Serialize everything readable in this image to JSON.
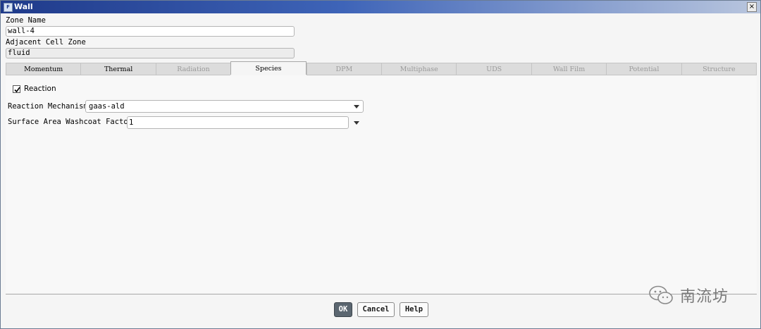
{
  "window": {
    "title": "Wall",
    "title_icon": "F",
    "close_icon": "close-icon",
    "close_glyph": "×"
  },
  "zone": {
    "name_label": "Zone Name",
    "name_value": "wall-4",
    "cell_zone_label": "Adjacent Cell Zone",
    "cell_zone_value": "fluid"
  },
  "tabs": [
    {
      "label": "Momentum",
      "state": "enabled"
    },
    {
      "label": "Thermal",
      "state": "enabled"
    },
    {
      "label": "Radiation",
      "state": "disabled"
    },
    {
      "label": "Species",
      "state": "active"
    },
    {
      "label": "DPM",
      "state": "disabled"
    },
    {
      "label": "Multiphase",
      "state": "disabled"
    },
    {
      "label": "UDS",
      "state": "disabled"
    },
    {
      "label": "Wall Film",
      "state": "disabled"
    },
    {
      "label": "Potential",
      "state": "disabled"
    },
    {
      "label": "Structure",
      "state": "disabled"
    }
  ],
  "species": {
    "reaction_label": "Reaction",
    "reaction_checked": true,
    "mechanism_label": "Reaction Mechanism",
    "mechanism_value": "gaas-ald",
    "washcoat_label": "Surface Area Washcoat Factor",
    "washcoat_value": "1"
  },
  "buttons": {
    "ok": "OK",
    "cancel": "Cancel",
    "help": "Help"
  },
  "watermark": {
    "text": "南流坊",
    "icon": "wechat-icon"
  },
  "colors": {
    "titlebar_start": "#1f3a8a",
    "primary_button": "#5b6670",
    "disabled_tab_text": "#9a9a9a"
  }
}
